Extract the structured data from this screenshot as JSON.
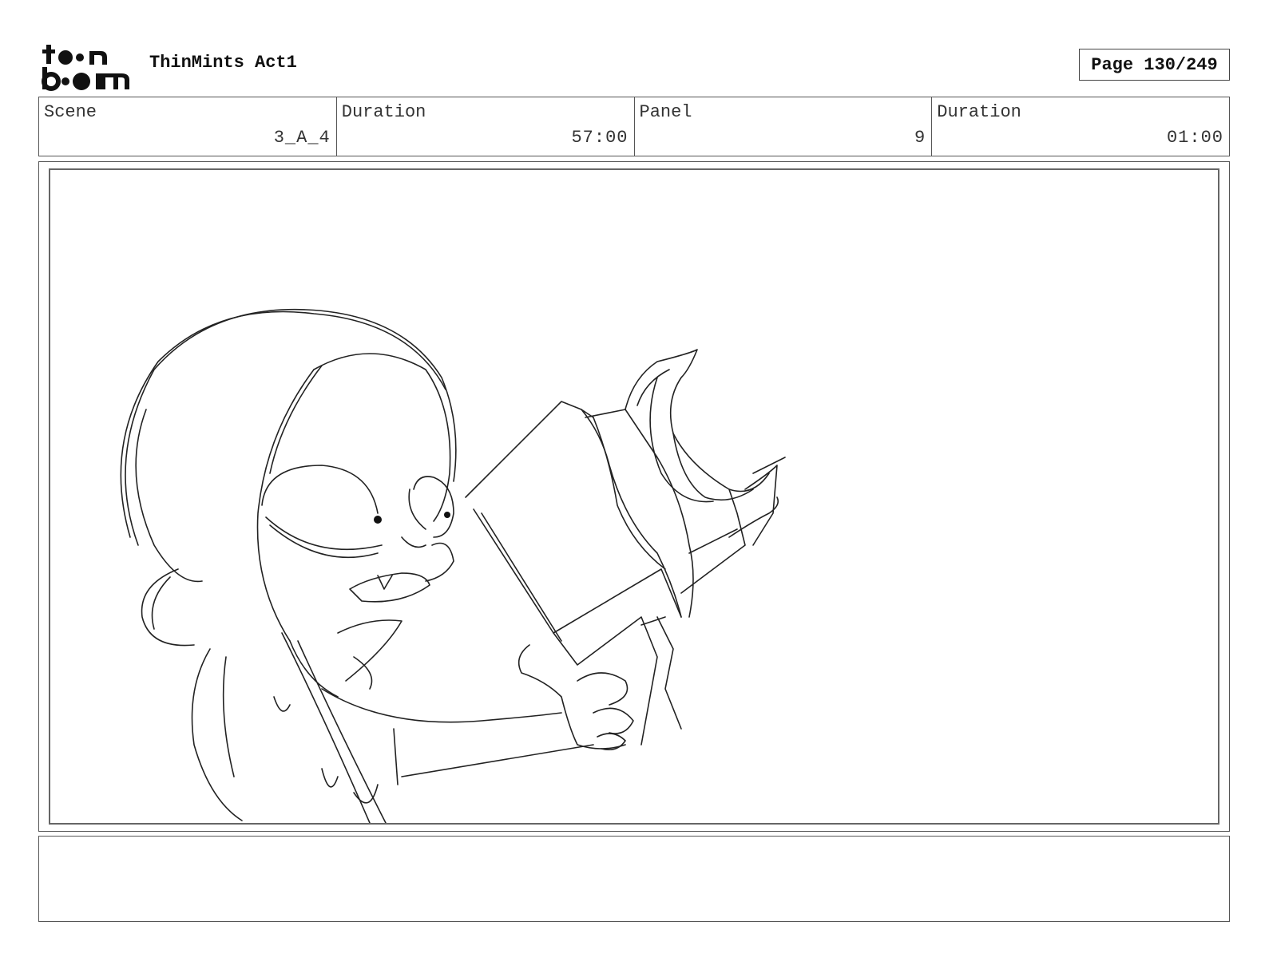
{
  "header": {
    "logo_alt": "toon boom",
    "title": "ThinMints Act1",
    "page_indicator": "Page 130/249"
  },
  "info": {
    "scene_label": "Scene",
    "scene_value": "3_A_4",
    "scene_duration_label": "Duration",
    "scene_duration_value": "57:00",
    "panel_label": "Panel",
    "panel_value": "9",
    "panel_duration_label": "Duration",
    "panel_duration_value": "01:00"
  },
  "panel": {
    "sketch_subject": "girl-reading-book-sketch"
  },
  "notes": {
    "text": ""
  }
}
